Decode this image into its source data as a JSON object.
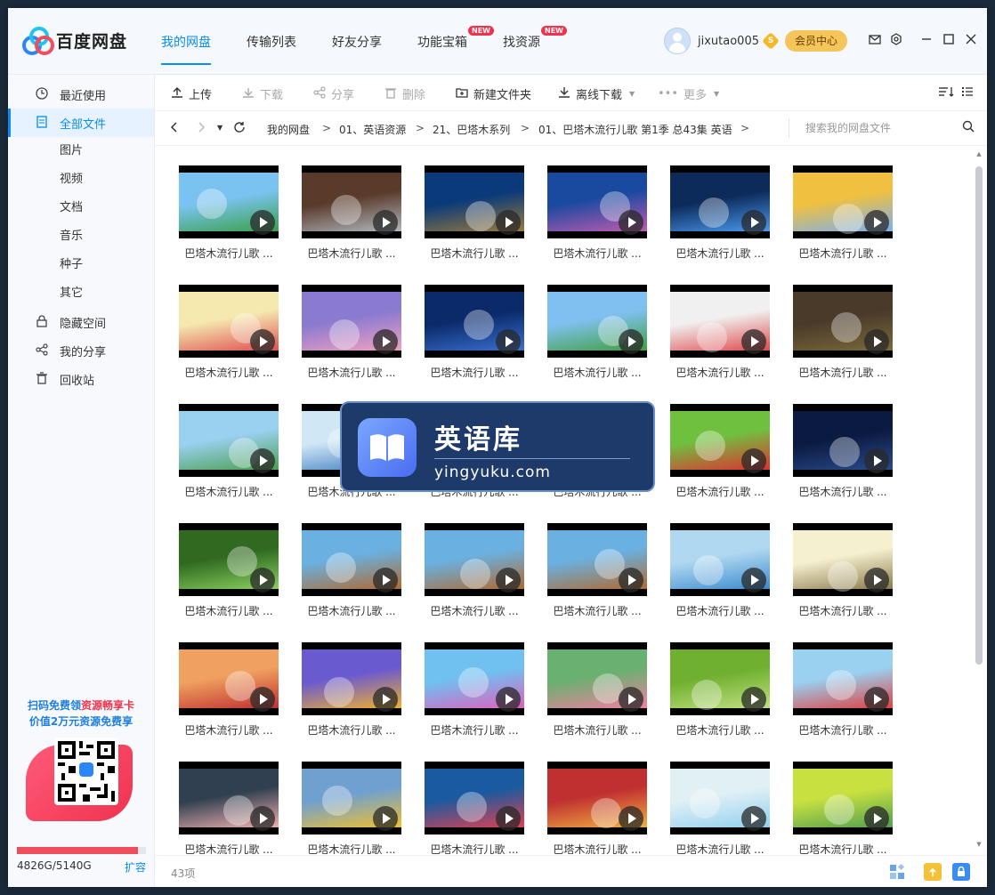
{
  "header": {
    "logo_text": "百度网盘",
    "nav": [
      {
        "label": "我的网盘",
        "active": true,
        "badge": ""
      },
      {
        "label": "传输列表",
        "active": false,
        "badge": ""
      },
      {
        "label": "好友分享",
        "active": false,
        "badge": ""
      },
      {
        "label": "功能宝箱",
        "active": false,
        "badge": "NEW"
      },
      {
        "label": "找资源",
        "active": false,
        "badge": "NEW"
      }
    ],
    "username": "jixutao005",
    "vip_mark": "S",
    "vip_button": "会员中心",
    "icons": [
      "mail-icon",
      "settings-icon",
      "minimize-icon",
      "maximize-icon",
      "close-icon"
    ]
  },
  "sidebar": {
    "items": [
      {
        "label": "最近使用",
        "icon": "clock-icon"
      },
      {
        "label": "全部文件",
        "icon": "file-icon",
        "active": true
      },
      {
        "label": "隐藏空间",
        "icon": "lock-icon"
      },
      {
        "label": "我的分享",
        "icon": "share-icon"
      },
      {
        "label": "回收站",
        "icon": "trash-icon"
      }
    ],
    "subitems": [
      "图片",
      "视频",
      "文档",
      "音乐",
      "种子",
      "其它"
    ],
    "promo_line1_a": "扫码免费领",
    "promo_line1_b": "资源畅享卡",
    "promo_line2": "价值2万元资源免费享",
    "storage_text": "4826G/5140G",
    "storage_fraction": 0.939,
    "expand_label": "扩容"
  },
  "toolbar": {
    "upload": "上传",
    "download": "下载",
    "share": "分享",
    "delete": "删除",
    "new_folder": "新建文件夹",
    "offline_download": "离线下载",
    "more": "更多"
  },
  "breadcrumb": {
    "items": [
      "我的网盘",
      "01、英语资源",
      "21、巴塔木系列",
      "01、巴塔木流行儿歌 第1季 总43集 英语"
    ],
    "sep": ">",
    "search_placeholder": "搜索我的网盘文件"
  },
  "files": {
    "label": "巴塔木流行儿歌 ...",
    "count": 36
  },
  "status": {
    "item_count": "43项"
  },
  "watermark": {
    "title": "英语库",
    "subtitle": "yingyuku.com"
  },
  "colors": {
    "accent": "#0a8cf2",
    "badge": "#f0324d",
    "vip": "#f3c55a"
  }
}
